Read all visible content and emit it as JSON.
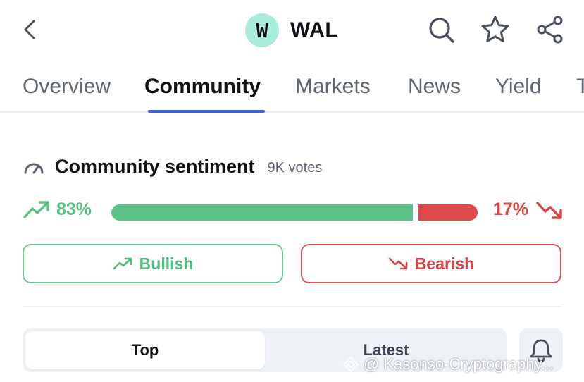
{
  "header": {
    "coin_logo_letter": "W",
    "coin_symbol": "WAL",
    "back_icon": "chevron-left-icon",
    "search_icon": "search-icon",
    "favorite_icon": "star-icon",
    "share_icon": "share-icon"
  },
  "tabs": [
    {
      "label": "Overview",
      "active": false
    },
    {
      "label": "Community",
      "active": true
    },
    {
      "label": "Markets",
      "active": false
    },
    {
      "label": "News",
      "active": false
    },
    {
      "label": "Yield",
      "active": false
    },
    {
      "label": "T",
      "active": false
    }
  ],
  "sentiment": {
    "title": "Community sentiment",
    "votes": "9K votes",
    "bullish_pct_label": "83%",
    "bearish_pct_label": "17%",
    "bullish_fraction": 0.83,
    "bearish_fraction": 0.17,
    "bullish_button": "Bullish",
    "bearish_button": "Bearish"
  },
  "feed": {
    "top_label": "Top",
    "latest_label": "Latest",
    "bell_icon": "bell-icon"
  },
  "watermark": {
    "text": "@ Kasonso-Cryptography..."
  },
  "colors": {
    "accent": "#3a5ee0",
    "bullish": "#5cc387",
    "bearish": "#dd4a4a",
    "coin_bg": "#a9ecdc"
  }
}
